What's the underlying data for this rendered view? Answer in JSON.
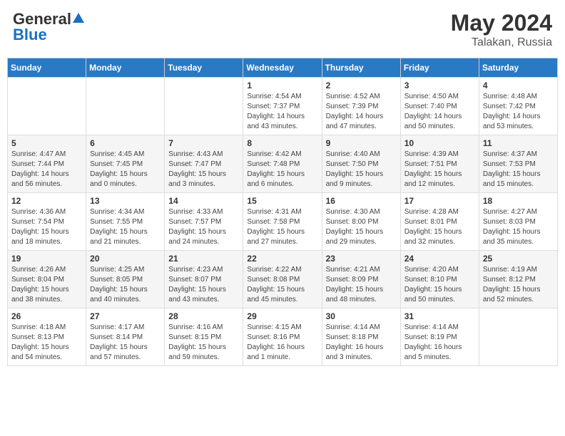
{
  "header": {
    "logo_general": "General",
    "logo_blue": "Blue",
    "title": "May 2024",
    "location": "Talakan, Russia"
  },
  "days_of_week": [
    "Sunday",
    "Monday",
    "Tuesday",
    "Wednesday",
    "Thursday",
    "Friday",
    "Saturday"
  ],
  "weeks": [
    [
      {
        "day": "",
        "info": ""
      },
      {
        "day": "",
        "info": ""
      },
      {
        "day": "",
        "info": ""
      },
      {
        "day": "1",
        "info": "Sunrise: 4:54 AM\nSunset: 7:37 PM\nDaylight: 14 hours\nand 43 minutes."
      },
      {
        "day": "2",
        "info": "Sunrise: 4:52 AM\nSunset: 7:39 PM\nDaylight: 14 hours\nand 47 minutes."
      },
      {
        "day": "3",
        "info": "Sunrise: 4:50 AM\nSunset: 7:40 PM\nDaylight: 14 hours\nand 50 minutes."
      },
      {
        "day": "4",
        "info": "Sunrise: 4:48 AM\nSunset: 7:42 PM\nDaylight: 14 hours\nand 53 minutes."
      }
    ],
    [
      {
        "day": "5",
        "info": "Sunrise: 4:47 AM\nSunset: 7:44 PM\nDaylight: 14 hours\nand 56 minutes."
      },
      {
        "day": "6",
        "info": "Sunrise: 4:45 AM\nSunset: 7:45 PM\nDaylight: 15 hours\nand 0 minutes."
      },
      {
        "day": "7",
        "info": "Sunrise: 4:43 AM\nSunset: 7:47 PM\nDaylight: 15 hours\nand 3 minutes."
      },
      {
        "day": "8",
        "info": "Sunrise: 4:42 AM\nSunset: 7:48 PM\nDaylight: 15 hours\nand 6 minutes."
      },
      {
        "day": "9",
        "info": "Sunrise: 4:40 AM\nSunset: 7:50 PM\nDaylight: 15 hours\nand 9 minutes."
      },
      {
        "day": "10",
        "info": "Sunrise: 4:39 AM\nSunset: 7:51 PM\nDaylight: 15 hours\nand 12 minutes."
      },
      {
        "day": "11",
        "info": "Sunrise: 4:37 AM\nSunset: 7:53 PM\nDaylight: 15 hours\nand 15 minutes."
      }
    ],
    [
      {
        "day": "12",
        "info": "Sunrise: 4:36 AM\nSunset: 7:54 PM\nDaylight: 15 hours\nand 18 minutes."
      },
      {
        "day": "13",
        "info": "Sunrise: 4:34 AM\nSunset: 7:55 PM\nDaylight: 15 hours\nand 21 minutes."
      },
      {
        "day": "14",
        "info": "Sunrise: 4:33 AM\nSunset: 7:57 PM\nDaylight: 15 hours\nand 24 minutes."
      },
      {
        "day": "15",
        "info": "Sunrise: 4:31 AM\nSunset: 7:58 PM\nDaylight: 15 hours\nand 27 minutes."
      },
      {
        "day": "16",
        "info": "Sunrise: 4:30 AM\nSunset: 8:00 PM\nDaylight: 15 hours\nand 29 minutes."
      },
      {
        "day": "17",
        "info": "Sunrise: 4:28 AM\nSunset: 8:01 PM\nDaylight: 15 hours\nand 32 minutes."
      },
      {
        "day": "18",
        "info": "Sunrise: 4:27 AM\nSunset: 8:03 PM\nDaylight: 15 hours\nand 35 minutes."
      }
    ],
    [
      {
        "day": "19",
        "info": "Sunrise: 4:26 AM\nSunset: 8:04 PM\nDaylight: 15 hours\nand 38 minutes."
      },
      {
        "day": "20",
        "info": "Sunrise: 4:25 AM\nSunset: 8:05 PM\nDaylight: 15 hours\nand 40 minutes."
      },
      {
        "day": "21",
        "info": "Sunrise: 4:23 AM\nSunset: 8:07 PM\nDaylight: 15 hours\nand 43 minutes."
      },
      {
        "day": "22",
        "info": "Sunrise: 4:22 AM\nSunset: 8:08 PM\nDaylight: 15 hours\nand 45 minutes."
      },
      {
        "day": "23",
        "info": "Sunrise: 4:21 AM\nSunset: 8:09 PM\nDaylight: 15 hours\nand 48 minutes."
      },
      {
        "day": "24",
        "info": "Sunrise: 4:20 AM\nSunset: 8:10 PM\nDaylight: 15 hours\nand 50 minutes."
      },
      {
        "day": "25",
        "info": "Sunrise: 4:19 AM\nSunset: 8:12 PM\nDaylight: 15 hours\nand 52 minutes."
      }
    ],
    [
      {
        "day": "26",
        "info": "Sunrise: 4:18 AM\nSunset: 8:13 PM\nDaylight: 15 hours\nand 54 minutes."
      },
      {
        "day": "27",
        "info": "Sunrise: 4:17 AM\nSunset: 8:14 PM\nDaylight: 15 hours\nand 57 minutes."
      },
      {
        "day": "28",
        "info": "Sunrise: 4:16 AM\nSunset: 8:15 PM\nDaylight: 15 hours\nand 59 minutes."
      },
      {
        "day": "29",
        "info": "Sunrise: 4:15 AM\nSunset: 8:16 PM\nDaylight: 16 hours\nand 1 minute."
      },
      {
        "day": "30",
        "info": "Sunrise: 4:14 AM\nSunset: 8:18 PM\nDaylight: 16 hours\nand 3 minutes."
      },
      {
        "day": "31",
        "info": "Sunrise: 4:14 AM\nSunset: 8:19 PM\nDaylight: 16 hours\nand 5 minutes."
      },
      {
        "day": "",
        "info": ""
      }
    ]
  ]
}
